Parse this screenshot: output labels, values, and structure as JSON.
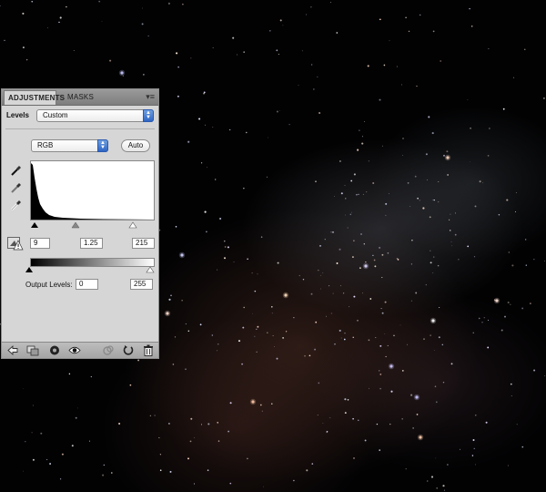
{
  "panel": {
    "tabs": [
      {
        "label": "ADJUSTMENTS",
        "active": true
      },
      {
        "label": "MASKS",
        "active": false
      }
    ],
    "menu_glyph": "▾≡",
    "levels_label": "Levels",
    "preset_value": "Custom",
    "channel_value": "RGB",
    "auto_label": "Auto",
    "input_black": "9",
    "input_gamma": "1.25",
    "input_white": "215",
    "output_label": "Output Levels:",
    "output_black": "0",
    "output_white": "255"
  },
  "eyedroppers": [
    "black-point-eyedropper-icon",
    "gray-point-eyedropper-icon",
    "white-point-eyedropper-icon"
  ],
  "bottom_icons": [
    "back-arrow-icon",
    "clip-to-layer-icon",
    "layer-visibility-toggle-icon",
    "eye-icon",
    "previous-state-icon",
    "reset-icon",
    "trash-icon"
  ],
  "colors": {
    "panel_bg": "#d6d6d6",
    "select_arrow_blue": "#2f66c4",
    "background": "#020203"
  }
}
